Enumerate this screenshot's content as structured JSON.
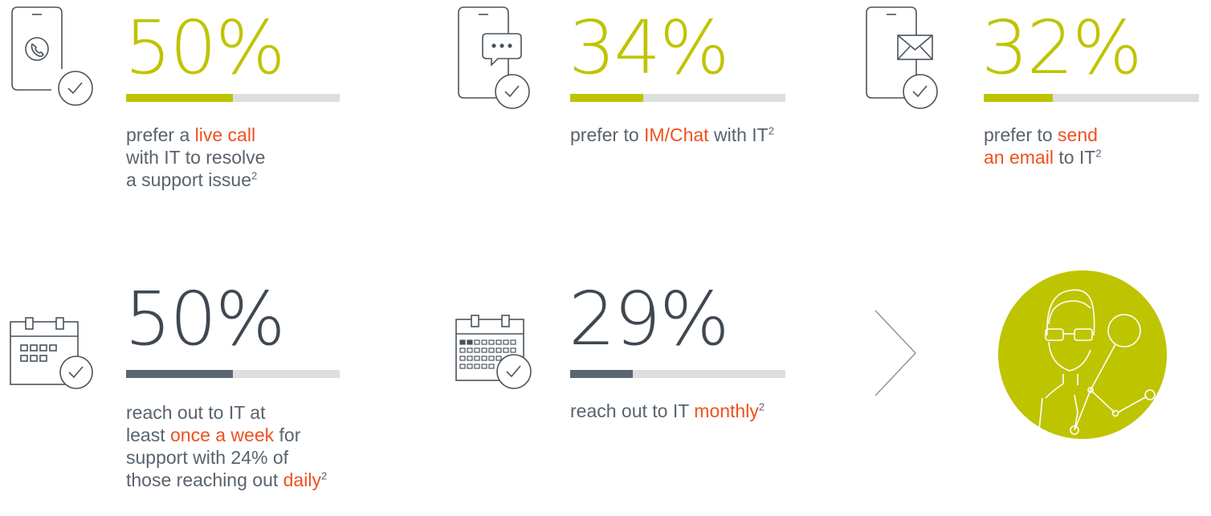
{
  "colors": {
    "accent_green": "#bfc400",
    "dark": "#3f4851",
    "highlight": "#f0501e",
    "track": "#dcdee0"
  },
  "stats": [
    {
      "icon": "phone-call-check-icon",
      "percent": "50%",
      "fill_fraction": 0.5,
      "desc": [
        [
          {
            "t": "prefer a "
          },
          {
            "t": "live call",
            "hl": true
          }
        ],
        [
          {
            "t": "with IT to resolve"
          }
        ],
        [
          {
            "t": "a support issue"
          },
          {
            "t": "2",
            "sup": true
          }
        ]
      ]
    },
    {
      "icon": "phone-chat-check-icon",
      "percent": "34%",
      "fill_fraction": 0.34,
      "desc": [
        [
          {
            "t": "prefer to "
          },
          {
            "t": "IM/Chat",
            "hl": true
          },
          {
            "t": " with IT"
          },
          {
            "t": "2",
            "sup": true
          }
        ]
      ]
    },
    {
      "icon": "phone-email-check-icon",
      "percent": "32%",
      "fill_fraction": 0.32,
      "desc": [
        [
          {
            "t": "prefer to "
          },
          {
            "t": "send",
            "hl": true
          }
        ],
        [
          {
            "t": "an email",
            "hl": true
          },
          {
            "t": " to IT"
          },
          {
            "t": "2",
            "sup": true
          }
        ]
      ]
    },
    {
      "icon": "calendar-weekly-check-icon",
      "percent": "50%",
      "fill_fraction": 0.5,
      "desc": [
        [
          {
            "t": "reach out to IT at"
          }
        ],
        [
          {
            "t": "least "
          },
          {
            "t": "once a week",
            "hl": true
          },
          {
            "t": " for"
          }
        ],
        [
          {
            "t": "support with 24% of"
          }
        ],
        [
          {
            "t": "those reaching out "
          },
          {
            "t": "daily",
            "hl": true
          },
          {
            "t": "2",
            "sup": true
          }
        ]
      ]
    },
    {
      "icon": "calendar-monthly-check-icon",
      "percent": "29%",
      "fill_fraction": 0.29,
      "desc": [
        [
          {
            "t": "reach out to IT "
          },
          {
            "t": "monthly",
            "hl": true
          },
          {
            "t": "2",
            "sup": true
          }
        ]
      ]
    }
  ],
  "decorations": {
    "arrow": "chevron-right-icon",
    "avatar": "support-technician-avatar-icon"
  }
}
